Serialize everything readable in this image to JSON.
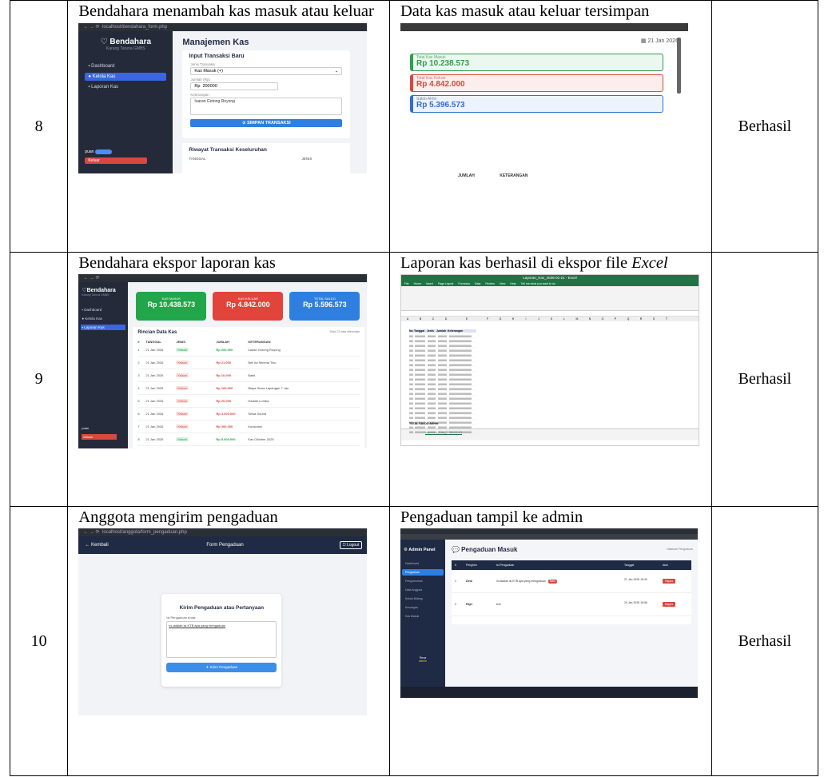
{
  "rows": [
    {
      "no": "8",
      "left": {
        "caption": "Bendahara menambah kas masuk atau keluar",
        "shot": {
          "url": "localhost/bendahara_form.php",
          "brand": "Bendahara",
          "brand_sub": "Karang Taruna GMBS",
          "menu": [
            "Dashboard",
            "Kelola Kas",
            "Laporan Kas"
          ],
          "user": "puan",
          "logout": "Keluar",
          "page_title": "Manajemen Kas",
          "form_title": "Input Transaksi Baru",
          "label_jenis": "Jenis Transaksi",
          "jenis_value": "Kas Masuk (+)",
          "label_jumlah": "Jumlah (Rp)",
          "rp_prefix": "Rp",
          "jumlah_value": "200000",
          "label_ket": "Keterangan",
          "ket_value": "Iuaran Gotong Royong",
          "save_button": "SIMPAN TRANSAKSI",
          "history_title": "Riwayat Transaksi Keseluruhan",
          "col_tanggal": "TANGGAL",
          "col_jenis": "JENIS"
        }
      },
      "right": {
        "caption": "Data kas masuk atau keluar tersimpan",
        "shot": {
          "date": "21 Jan 2026",
          "cards": [
            {
              "label": "Total Kas Masuk",
              "value": "Rp 10.238.573",
              "color": "#2e9e4f",
              "bg": "#ecf8ef"
            },
            {
              "label": "Total Kas Keluar",
              "value": "Rp 4.842.000",
              "color": "#d9473f",
              "bg": "#fdeeee"
            },
            {
              "label": "Saldo Akhir",
              "value": "Rp 5.396.573",
              "color": "#2f6fcf",
              "bg": "#edf3fc"
            }
          ],
          "col_jumlah": "JUMLAH",
          "col_keterangan": "KETERANGAN"
        }
      },
      "result": "Berhasil"
    },
    {
      "no": "9",
      "left": {
        "caption": "Bendahara ekspor laporan kas",
        "shot": {
          "brand": "Bendahara",
          "brand_sub": "Karang Taruna GMBS",
          "menu": [
            "Dashboard",
            "Kelola Kas",
            "Laporan Kas"
          ],
          "user": "puan",
          "logout": "Keluar",
          "cards": [
            {
              "label": "KAS MASUK",
              "value": "Rp 10.438.573",
              "bg": "#22a64a"
            },
            {
              "label": "KAS KELUAR",
              "value": "Rp 4.842.000",
              "bg": "#e0443b"
            },
            {
              "label": "TOTAL SALDO",
              "value": "Rp 5.596.573",
              "bg": "#2f7fe0"
            }
          ],
          "table_title": "Rincian Data Kas",
          "export_label": "Total: 21 data ditemukan",
          "headers": [
            "#",
            "TANGGAL",
            "JENIS",
            "JUMLAH",
            "KETERANGAN"
          ],
          "rows": [
            {
              "no": "1",
              "tgl": "21 Jan 2026",
              "jenis": "Masuk",
              "jumlah": "Rp 200.000",
              "ket": "Iuaran Gotong Royong"
            },
            {
              "no": "2",
              "tgl": "21 Jan 2026",
              "jenis": "Keluar",
              "jumlah": "Rp 21.000",
              "ket": "Beli Air Mineral Tisu"
            },
            {
              "no": "3",
              "tgl": "21 Jan 2026",
              "jenis": "Keluar",
              "jumlah": "Rp 10.000",
              "ket": "Bakti"
            },
            {
              "no": "4",
              "tgl": "21 Jan 2026",
              "jenis": "Keluar",
              "jumlah": "Rp 160.000",
              "ket": "Biaya Sewa Lapangan 7 Jan"
            },
            {
              "no": "5",
              "tgl": "21 Jan 2026",
              "jenis": "Keluar",
              "jumlah": "Rp 20.000",
              "ket": "Hadiah Lomba"
            },
            {
              "no": "6",
              "tgl": "21 Jan 2026",
              "jenis": "Keluar",
              "jumlah": "Rp 4.000.000",
              "ket": "Sewa Sound"
            },
            {
              "no": "7",
              "tgl": "21 Jan 2026",
              "jenis": "Keluar",
              "jumlah": "Rp 300.000",
              "ket": "Konsumsi"
            },
            {
              "no": "8",
              "tgl": "21 Jan 2026",
              "jenis": "Masuk",
              "jumlah": "Rp 5.000.000",
              "ket": "Kas Oktober 2025"
            }
          ]
        }
      },
      "right": {
        "caption_prefix": "Laporan kas berhasil di ekspor file ",
        "caption_italic": "Excel",
        "shot": {
          "title": "Laporan_Kas_2026-01-21 - Excel",
          "ribbon_tabs": [
            "File",
            "Home",
            "Insert",
            "Page Layout",
            "Formulas",
            "Data",
            "Review",
            "View",
            "Help",
            "Tell me what you want to do"
          ],
          "col_letters": [
            "A",
            "B",
            "C",
            "D",
            "E",
            "F",
            "G",
            "H",
            "I",
            "J",
            "K",
            "L",
            "M",
            "N",
            "O",
            "P",
            "Q",
            "R",
            "S",
            "T"
          ],
          "header_cells": [
            "No",
            "Tanggal",
            "Jenis",
            "Jumlah",
            "Keterangan"
          ],
          "sheet_tab": "Laporan_Kas_2026-01-21",
          "total_label": "TOTAL SALDO AKHIR"
        }
      },
      "result": "Berhasil"
    },
    {
      "no": "10",
      "left": {
        "caption": "Anggota mengirim pengaduan",
        "shot": {
          "url": "localhost/anggota/form_pengaduan.php",
          "back": "← Kembali",
          "header_title": "Form Pengaduan",
          "logout": "Logout",
          "card_title": "Kirim Pengaduan atau Pertanyaan",
          "label": "Isi Pengaduan Anda:",
          "textarea_value": "ini adalah isi KTB apa yang mengaduan",
          "submit": "Kirim Pengaduan"
        }
      },
      "right": {
        "caption": "Pengaduan tampil ke admin",
        "shot": {
          "side_title": "Admin Panel",
          "menu": [
            "Dashboard",
            "Pengaduan",
            "Pengumuman",
            "Data Anggota",
            "Kelola Bidang",
            "Keuangan",
            "Kas Masuk"
          ],
          "user": "Reza",
          "role": "admin",
          "page_title": "Pengaduan Masuk",
          "page_right": "Halaman Pengaduan",
          "headers": [
            "#",
            "Pengirim",
            "Isi Pengaduan",
            "Tanggal",
            "Aksi"
          ],
          "rows": [
            {
              "no": "1",
              "nama": "Dewi",
              "isi": "ini adalah isi KTB apa yang mengaduan",
              "badge": "Baru",
              "tgl": "21 Jan 2026 15:42",
              "aksi": "Hapus"
            },
            {
              "no": "2",
              "nama": "Rajiv",
              "isi": "test",
              "badge": "",
              "tgl": "19 Jan 2026 15:56",
              "aksi": "Hapus"
            }
          ]
        }
      },
      "result": "Berhasil"
    }
  ]
}
